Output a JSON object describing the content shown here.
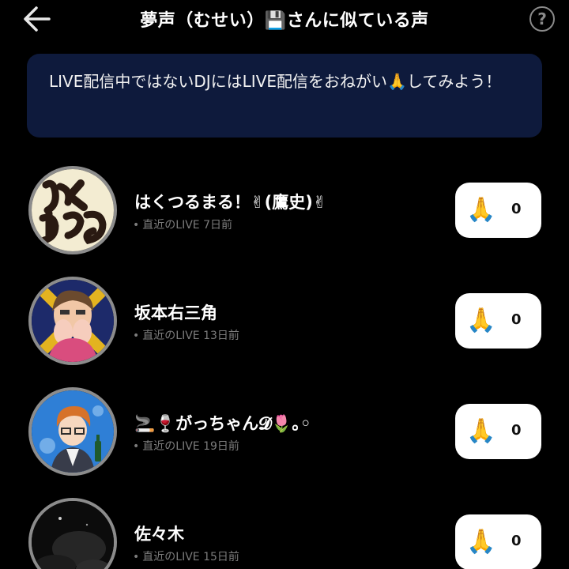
{
  "header": {
    "title": "夢声（むせい）💾さんに似ている声",
    "help_label": "?"
  },
  "banner": {
    "text": "LIVE配信中ではないDJにはLIVE配信をおねがい🙏してみよう！"
  },
  "dj_list": [
    {
      "name": "はくつるまる！✌(鷹史)✌",
      "last_live": "直近のLIVE 7日前",
      "pray_icon": "🙏",
      "count": "0"
    },
    {
      "name": "坂本右三角",
      "last_live": "直近のLIVE 13日前",
      "pray_icon": "🙏",
      "count": "0"
    },
    {
      "name": "🚬🍷がっちゃん𝓓🌷｡◦",
      "last_live": "直近のLIVE 19日前",
      "pray_icon": "🙏",
      "count": "0"
    },
    {
      "name": "佐々木",
      "last_live": "直近のLIVE 15日前",
      "pray_icon": "🙏",
      "count": "0"
    }
  ],
  "icons": {
    "back": "arrow-left",
    "help": "question-circle",
    "request": "praying-hands"
  },
  "colors": {
    "background": "#000000",
    "banner": "#0e1a3c",
    "button": "#ffffff",
    "meta_text": "#7c7c7c"
  }
}
